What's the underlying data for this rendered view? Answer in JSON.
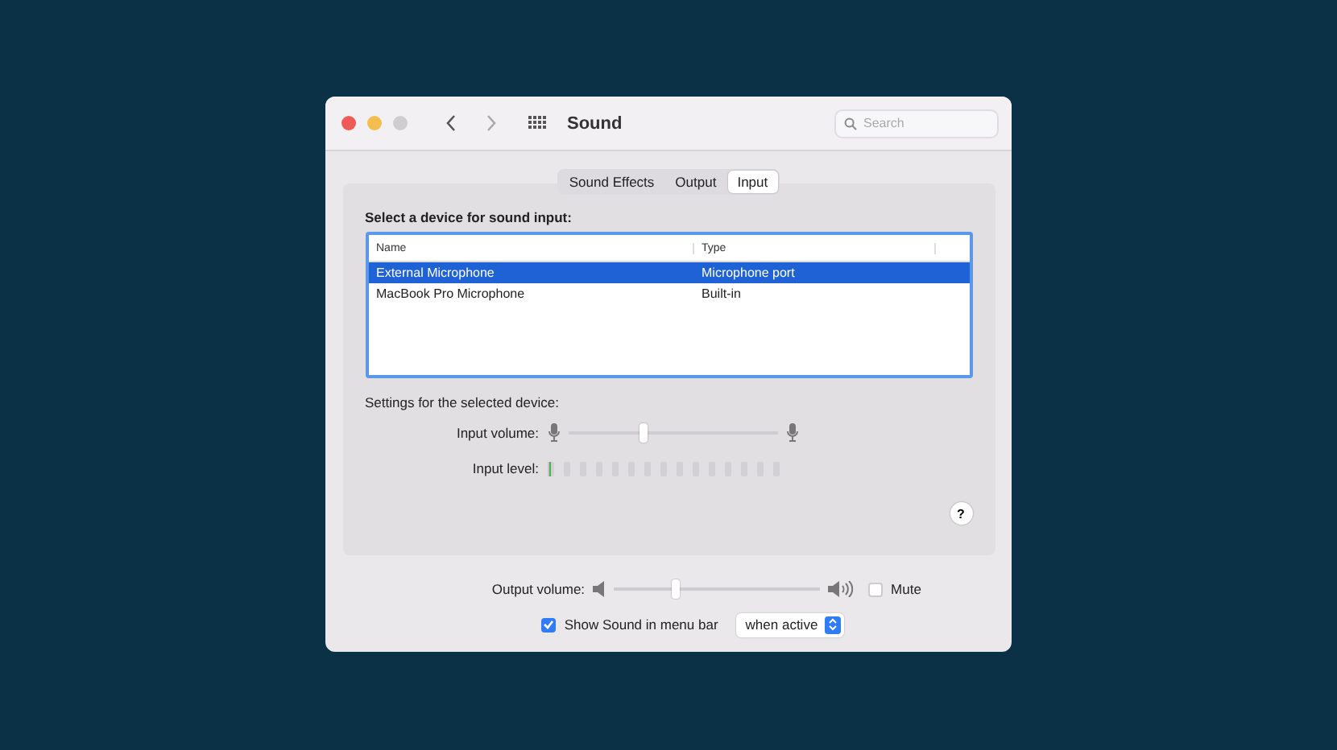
{
  "window": {
    "title": "Sound"
  },
  "search": {
    "placeholder": "Search"
  },
  "tabs": [
    {
      "label": "Sound Effects",
      "selected": false
    },
    {
      "label": "Output",
      "selected": false
    },
    {
      "label": "Input",
      "selected": true
    }
  ],
  "device_list": {
    "heading": "Select a device for sound input:",
    "columns": [
      "Name",
      "Type"
    ],
    "rows": [
      {
        "cells": [
          "External Microphone",
          "Microphone port"
        ],
        "selected": true
      },
      {
        "cells": [
          "MacBook Pro Microphone",
          "Built-in"
        ],
        "selected": false
      }
    ]
  },
  "settings": {
    "heading": "Settings for the selected device:",
    "input_volume": {
      "label": "Input volume:",
      "level": 0.36
    },
    "input_level": {
      "label": "Input level:",
      "level": 0
    }
  },
  "help": {
    "label": "?"
  },
  "output_volume": {
    "label": "Output volume:",
    "level": 0.3
  },
  "mute": {
    "label": "Mute",
    "checked": false
  },
  "show_in_menu_bar": {
    "label": "Show Sound in menu bar",
    "checked": true
  },
  "menu_bar_mode": {
    "value": "when active"
  }
}
